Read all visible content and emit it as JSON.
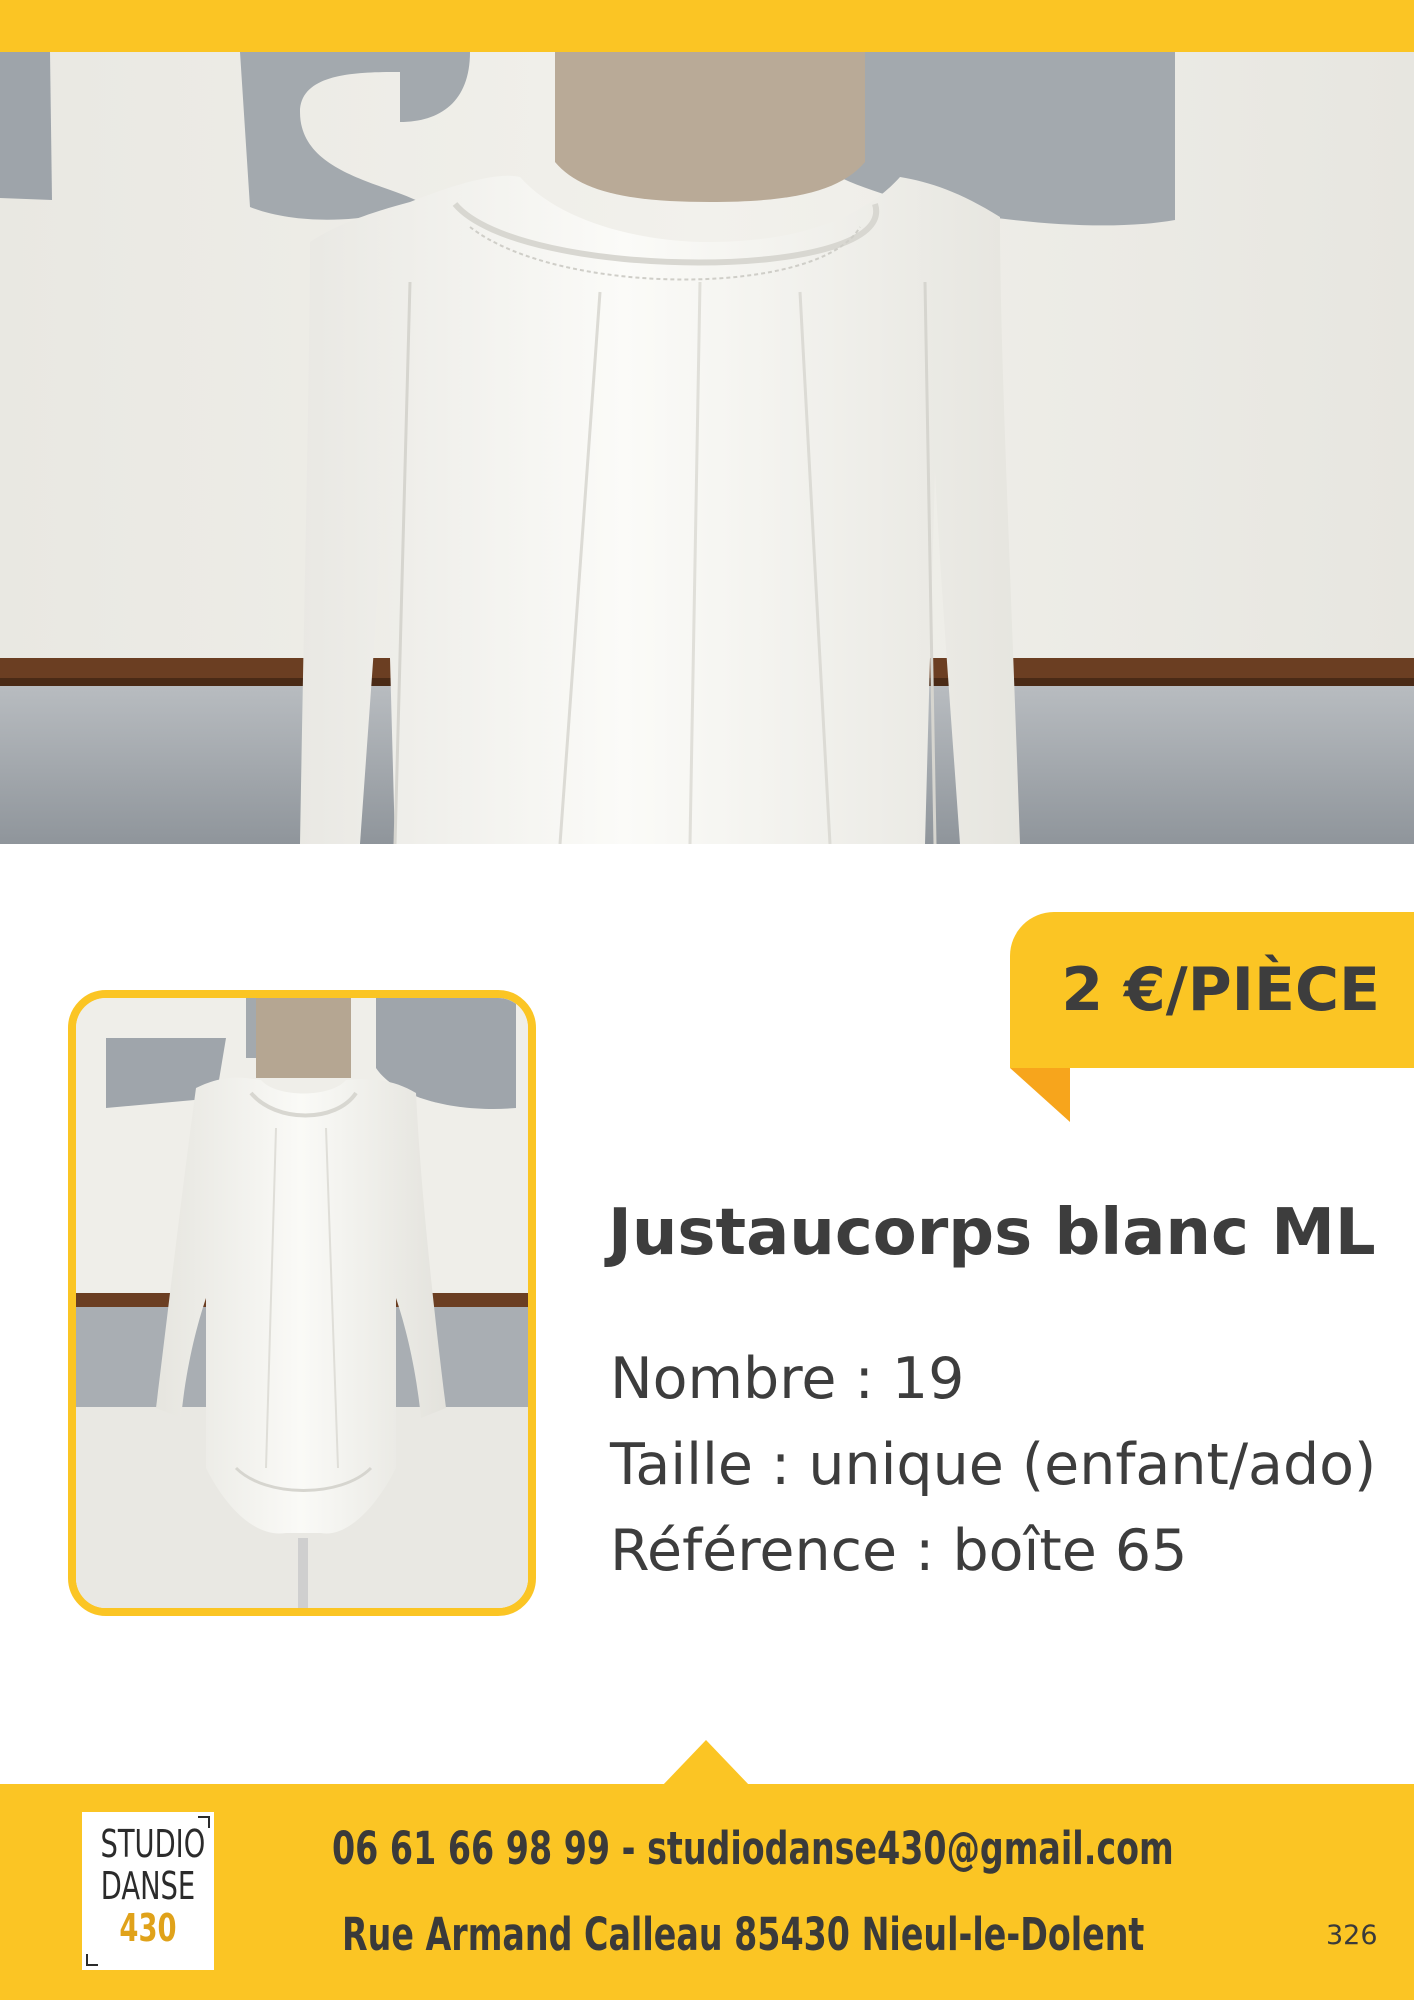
{
  "price": {
    "label": "2 €/PIÈCE"
  },
  "product": {
    "title": "Justaucorps blanc ML",
    "quantity": "Nombre : 19",
    "size": "Taille : unique (enfant/ado)",
    "reference": "Référence : boîte 65"
  },
  "footer": {
    "logo": {
      "line1": "STUDIO",
      "line2": "DANSE",
      "line3": "430"
    },
    "contact": "06 61 66 98 99 - studiodanse430@gmail.com",
    "address": "Rue Armand Calleau 85430 Nieul-le-Dolent",
    "page_number": "326"
  },
  "colors": {
    "accent": "#fbc524",
    "accent_dark": "#f7a51c",
    "text": "#3d3d3d"
  }
}
